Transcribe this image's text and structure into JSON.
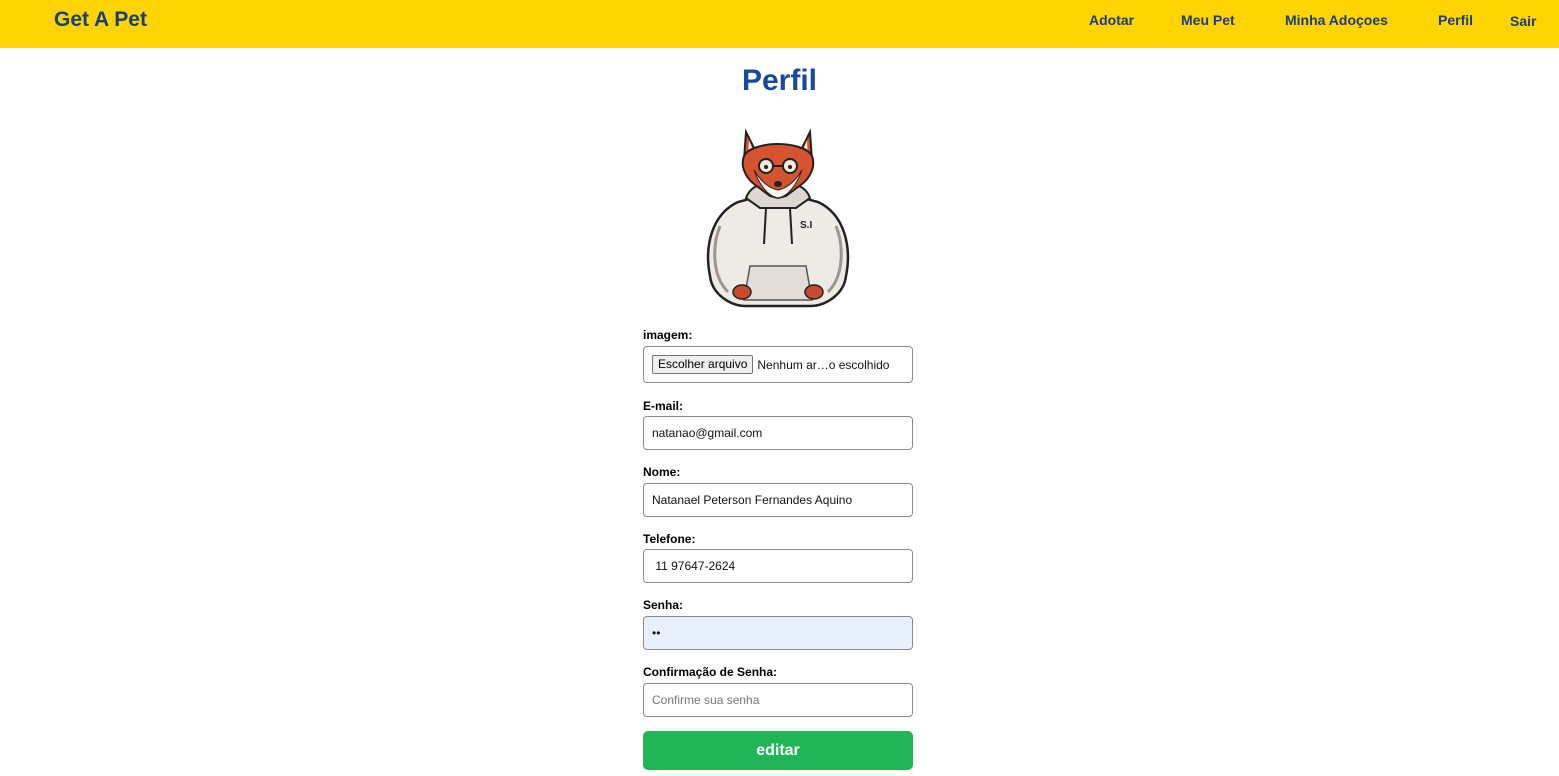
{
  "navbar": {
    "logo": "Get A Pet",
    "links": [
      {
        "label": "Adotar"
      },
      {
        "label": "Meu Pet"
      },
      {
        "label": "Minha Adoçoes"
      },
      {
        "label": "Perfil"
      },
      {
        "label": "Sair"
      }
    ]
  },
  "page": {
    "title": "Perfil"
  },
  "profile": {
    "avatar_icon": "fox-in-hoodie-avatar",
    "avatar_text": "S.I"
  },
  "form": {
    "image": {
      "label": "imagem:",
      "button_label": "Escolher arquivo",
      "status": "Nenhum ar…o escolhido"
    },
    "email": {
      "label": "E-mail:",
      "value": "natanao@gmail.com"
    },
    "name": {
      "label": "Nome:",
      "value": "Natanael Peterson Fernandes Aquino"
    },
    "phone": {
      "label": "Telefone:",
      "value": " 11 97647-2624"
    },
    "password": {
      "label": "Senha:",
      "value": "••"
    },
    "password_confirm": {
      "label": "Confirmação de Senha:",
      "placeholder": "Confirme sua senha",
      "value": ""
    },
    "submit_label": "editar"
  },
  "colors": {
    "navbar_bg": "#ffd400",
    "nav_text": "#1a3f7a",
    "title": "#174a9c",
    "submit_bg": "#22b558",
    "autofill_bg": "#e8f0fe"
  }
}
